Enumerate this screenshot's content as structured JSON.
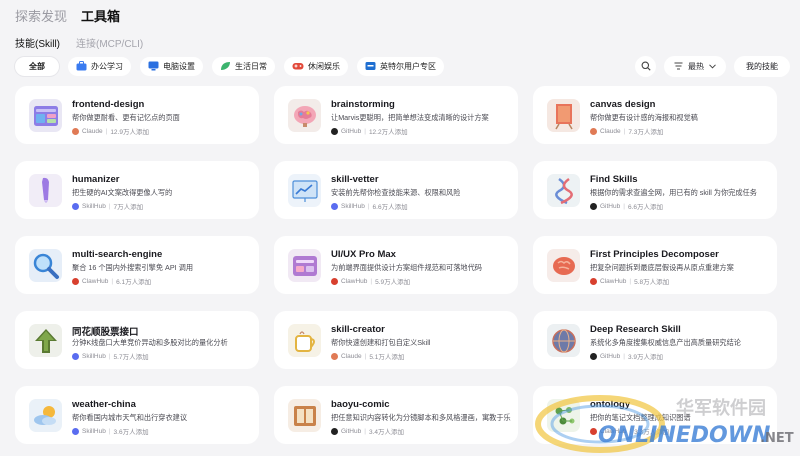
{
  "top_tabs": [
    "探索发现",
    "工具箱"
  ],
  "sub_tabs": [
    "技能(Skill)",
    "连接(MCP/CLI)"
  ],
  "filters": [
    {
      "label": "全部",
      "icon": "",
      "color": ""
    },
    {
      "label": "办公学习",
      "icon": "briefcase-icon",
      "color": "#3a7bf0"
    },
    {
      "label": "电脑设置",
      "icon": "monitor-icon",
      "color": "#2a6fe0"
    },
    {
      "label": "生活日常",
      "icon": "leaf-icon",
      "color": "#3cb46e"
    },
    {
      "label": "休闲娱乐",
      "icon": "gamepad-icon",
      "color": "#e24a3b"
    },
    {
      "label": "英特尔用户专区",
      "icon": "intel-icon",
      "color": "#1f6fd1"
    }
  ],
  "sort_label": "最热",
  "my_skills_label": "我的技能",
  "cards": [
    {
      "title": "frontend-design",
      "desc": "帮你做更耐看、更有记忆点的页面",
      "source": "Claude",
      "count": "12.9万人添加",
      "icon": "layout-icon",
      "icon_bg": "#e9e7f4",
      "src_color": "#e07a55"
    },
    {
      "title": "brainstorming",
      "desc": "让Marvis更聪明，把简单想法变成清晰的设计方案",
      "source": "GitHub",
      "count": "12.2万人添加",
      "icon": "brain-icon",
      "icon_bg": "#f3ece9",
      "src_color": "#222222"
    },
    {
      "title": "canvas design",
      "desc": "帮你做更有设计感的海报和视觉稿",
      "source": "Claude",
      "count": "7.3万人添加",
      "icon": "canvas-icon",
      "icon_bg": "#f5e8e2",
      "src_color": "#e07a55"
    },
    {
      "title": "humanizer",
      "desc": "把生硬的AI文案改得更像人写的",
      "source": "SkillHub",
      "count": "7万人添加",
      "icon": "pen-icon",
      "icon_bg": "#f1edf7",
      "src_color": "#5a6cf0"
    },
    {
      "title": "skill-vetter",
      "desc": "安装前先帮你检查技能来源、权限和风险",
      "source": "SkillHub",
      "count": "6.6万人添加",
      "icon": "chart-board-icon",
      "icon_bg": "#edf3fa",
      "src_color": "#5a6cf0"
    },
    {
      "title": "Find Skills",
      "desc": "根据你的需求查遍全网，用已有的 skill 为你完成任务",
      "source": "GitHub",
      "count": "6.6万人添加",
      "icon": "dna-icon",
      "icon_bg": "#edf2f4",
      "src_color": "#222222"
    },
    {
      "title": "multi-search-engine",
      "desc": "聚合 16 个国内外搜索引擎免 API 调用",
      "source": "ClawHub",
      "count": "6.1万人添加",
      "icon": "magnifier-icon",
      "icon_bg": "#e6eef8",
      "src_color": "#d8402f"
    },
    {
      "title": "UI/UX Pro Max",
      "desc": "为前端界面提供设计方案组件规范和可落地代码",
      "source": "ClawHub",
      "count": "5.9万人添加",
      "icon": "ui-panel-icon",
      "icon_bg": "#f1e9f4",
      "src_color": "#d8402f"
    },
    {
      "title": "First Principles Decomposer",
      "desc": "把复杂问题拆到最底层假设再从原点重建方案",
      "source": "ClawHub",
      "count": "5.8万人添加",
      "icon": "brain-red-icon",
      "icon_bg": "#f6ece9",
      "src_color": "#d8402f"
    },
    {
      "title": "同花顺股票接口",
      "desc": "分钟K线盘口大单竞价异动和多股对比的量化分析",
      "source": "SkillHub",
      "count": "5.7万人添加",
      "icon": "arrow-up-icon",
      "icon_bg": "#eef0ea",
      "src_color": "#5a6cf0"
    },
    {
      "title": "skill-creator",
      "desc": "帮你快速创建和打包自定义Skill",
      "source": "Claude",
      "count": "5.1万人添加",
      "icon": "mug-icon",
      "icon_bg": "#f6f2e6",
      "src_color": "#e07a55"
    },
    {
      "title": "Deep Research Skill",
      "desc": "系统化多角度搜集权威信息产出高质量研究结论",
      "source": "GitHub",
      "count": "3.9万人添加",
      "icon": "globe-icon",
      "icon_bg": "#ecf0f2",
      "src_color": "#222222"
    },
    {
      "title": "weather-china",
      "desc": "帮你看国内城市天气和出行穿衣建议",
      "source": "SkillHub",
      "count": "3.6万人添加",
      "icon": "weather-icon",
      "icon_bg": "#eaf1f8",
      "src_color": "#5a6cf0"
    },
    {
      "title": "baoyu-comic",
      "desc": "把任意知识内容转化为分镜脚本和多风格漫画，寓教于乐",
      "source": "GitHub",
      "count": "3.4万人添加",
      "icon": "comic-icon",
      "icon_bg": "#f6ede4",
      "src_color": "#222222"
    },
    {
      "title": "ontology",
      "desc": "把你的笔记文档整理成知识图谱",
      "source": "ClawHub",
      "count": "3.3万人添加",
      "icon": "graph-icon",
      "icon_bg": "#eef4ea",
      "src_color": "#d8402f"
    }
  ],
  "watermark": {
    "line1": "华军软件园",
    "line2": "ONLINEDOWN",
    "suffix": ".NET"
  }
}
